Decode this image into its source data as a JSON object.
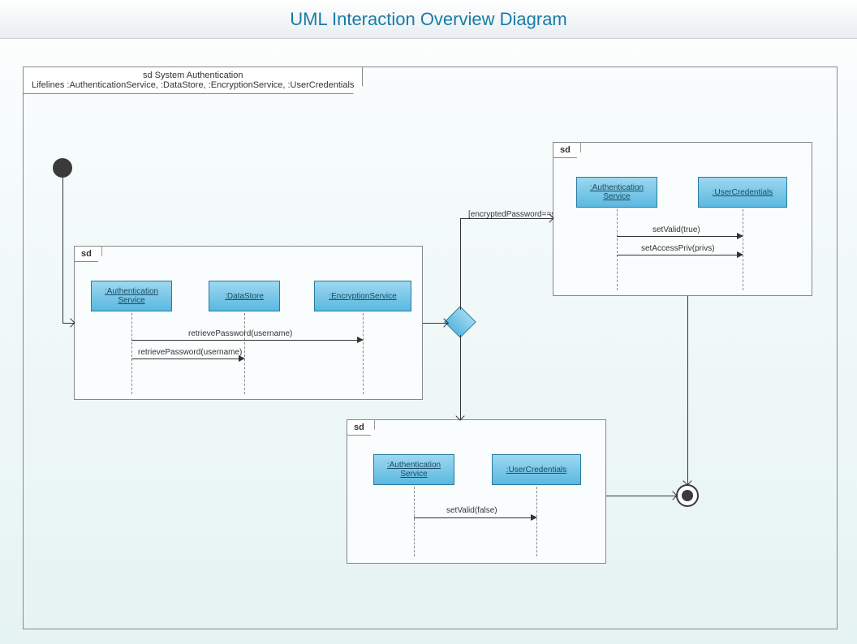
{
  "title": "UML Interaction Overview Diagram",
  "mainFrame": {
    "name": "sd System Authentication",
    "lifelines": "Lifelines :AuthenticationService, :DataStore, :EncryptionService, :UserCredentials"
  },
  "sd1": {
    "label": "sd",
    "box1": ":Authentication Service",
    "box2": ":DataStore",
    "box3": ":EncryptionService",
    "msg1": "retrievePassword(username)",
    "msg2": "retrievePassword(username)"
  },
  "sd2": {
    "label": "sd",
    "box1": ":Authentication Service",
    "box2": ":UserCredentials",
    "msg1": "setValid(true)",
    "msg2": "setAccessPriv(privs)"
  },
  "sd3": {
    "label": "sd",
    "box1": ":Authentication Service",
    "box2": ":UserCredentials",
    "msg1": "setValid(false)"
  },
  "guard": "[encryptedPassword==storedPassword]"
}
